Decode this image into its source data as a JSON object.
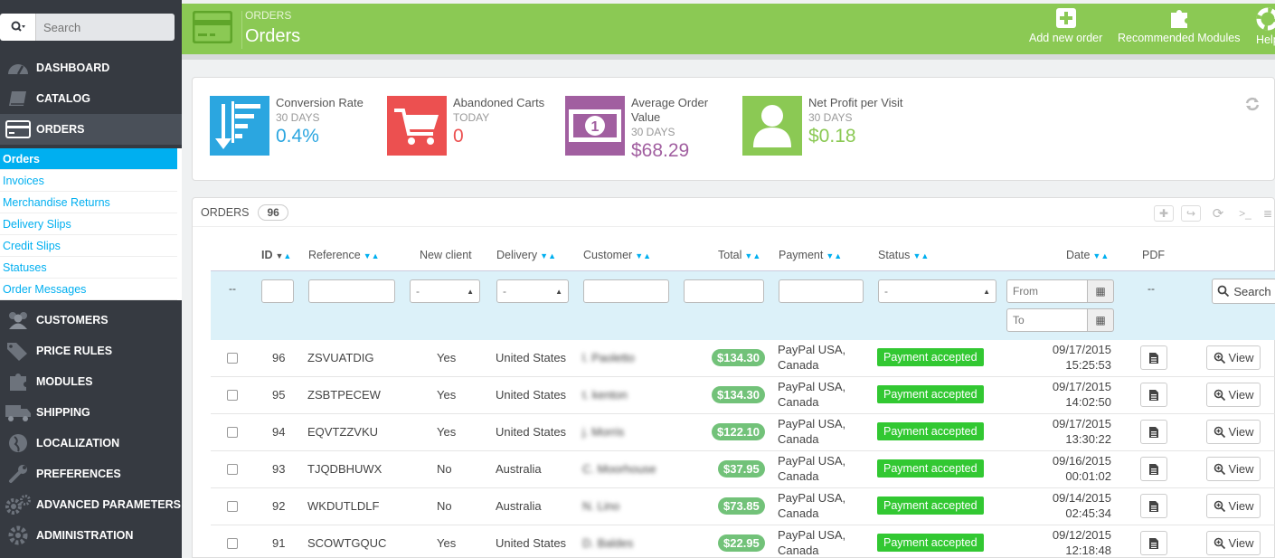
{
  "search": {
    "placeholder": "Search"
  },
  "menu": [
    {
      "label": "DASHBOARD",
      "icon": "dashboard-icon"
    },
    {
      "label": "CATALOG",
      "icon": "book-icon"
    },
    {
      "label": "ORDERS",
      "icon": "credit-card-icon",
      "active": true
    }
  ],
  "submenu": [
    "Orders",
    "Invoices",
    "Merchandise Returns",
    "Delivery Slips",
    "Credit Slips",
    "Statuses",
    "Order Messages"
  ],
  "menu2": [
    {
      "label": "CUSTOMERS",
      "icon": "users-icon"
    },
    {
      "label": "PRICE RULES",
      "icon": "tags-icon"
    },
    {
      "label": "MODULES",
      "icon": "puzzle-icon"
    },
    {
      "label": "SHIPPING",
      "icon": "truck-icon"
    },
    {
      "label": "LOCALIZATION",
      "icon": "globe-icon"
    },
    {
      "label": "PREFERENCES",
      "icon": "wrench-icon"
    },
    {
      "label": "ADVANCED PARAMETERS",
      "icon": "cogs-icon"
    },
    {
      "label": "ADMINISTRATION",
      "icon": "gear-icon"
    }
  ],
  "header": {
    "breadcrumb": "ORDERS",
    "title": "Orders",
    "add_new": "Add new order",
    "recommended": "Recommended Modules",
    "help": "Help"
  },
  "kpis": [
    {
      "title": "Conversion Rate",
      "sub": "30 DAYS",
      "value": "0.4%",
      "color": "#2ba6e0"
    },
    {
      "title": "Abandoned Carts",
      "sub": "TODAY",
      "value": "0",
      "color": "#ec5050"
    },
    {
      "title": "Average Order Value",
      "sub": "30 DAYS",
      "value": "$68.29",
      "color": "#a15fa0"
    },
    {
      "title": "Net Profit per Visit",
      "sub": "30 DAYS",
      "value": "$0.18",
      "color": "#8bc954"
    }
  ],
  "panel": {
    "title": "ORDERS",
    "count": "96"
  },
  "columns": {
    "id": "ID",
    "reference": "Reference",
    "new_client": "New client",
    "delivery": "Delivery",
    "customer": "Customer",
    "total": "Total",
    "payment": "Payment",
    "status": "Status",
    "date": "Date",
    "pdf": "PDF"
  },
  "filters": {
    "dash": "--",
    "select_dash": "-",
    "from": "From",
    "to": "To",
    "pdf_dash": "--",
    "search": "Search"
  },
  "rows": [
    {
      "id": "96",
      "ref": "ZSVUATDIG",
      "new": "Yes",
      "delivery": "United States",
      "customer": "l. Paoletto",
      "total": "$134.30",
      "pay1": "PayPal USA,",
      "pay2": "Canada",
      "status": "Payment accepted",
      "date": "09/17/2015",
      "time": "15:25:53",
      "view": "View"
    },
    {
      "id": "95",
      "ref": "ZSBTPECEW",
      "new": "Yes",
      "delivery": "United States",
      "customer": "t. kenton",
      "total": "$134.30",
      "pay1": "PayPal USA,",
      "pay2": "Canada",
      "status": "Payment accepted",
      "date": "09/17/2015",
      "time": "14:02:50",
      "view": "View"
    },
    {
      "id": "94",
      "ref": "EQVTZZVKU",
      "new": "Yes",
      "delivery": "United States",
      "customer": "j. Morris",
      "total": "$122.10",
      "pay1": "PayPal USA,",
      "pay2": "Canada",
      "status": "Payment accepted",
      "date": "09/17/2015",
      "time": "13:30:22",
      "view": "View"
    },
    {
      "id": "93",
      "ref": "TJQDBHUWX",
      "new": "No",
      "delivery": "Australia",
      "customer": "C. Moorhouse",
      "total": "$37.95",
      "pay1": "PayPal USA,",
      "pay2": "Canada",
      "status": "Payment accepted",
      "date": "09/16/2015",
      "time": "00:01:02",
      "view": "View"
    },
    {
      "id": "92",
      "ref": "WKDUTLDLF",
      "new": "No",
      "delivery": "Australia",
      "customer": "N. Lino",
      "total": "$73.85",
      "pay1": "PayPal USA,",
      "pay2": "Canada",
      "status": "Payment accepted",
      "date": "09/14/2015",
      "time": "02:45:34",
      "view": "View"
    },
    {
      "id": "91",
      "ref": "SCOWTGQUC",
      "new": "Yes",
      "delivery": "United States",
      "customer": "D. Baldes",
      "total": "$22.95",
      "pay1": "PayPal USA,",
      "pay2": "Canada",
      "status": "Payment accepted",
      "date": "09/12/2015",
      "time": "12:18:48",
      "view": "View"
    }
  ]
}
